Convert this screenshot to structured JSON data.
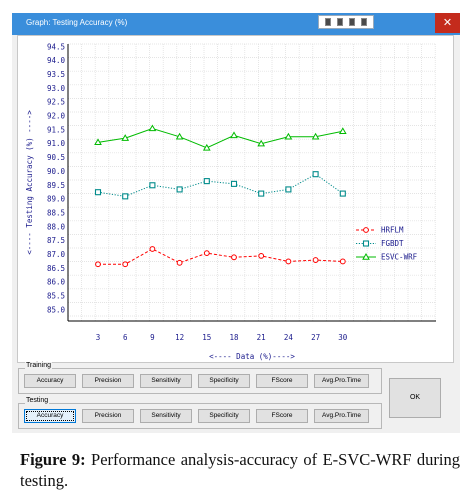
{
  "window": {
    "title": "Graph: Testing Accuracy (%)",
    "close_icon": "close-icon",
    "control_icon": "toolbar-icon"
  },
  "chart_data": {
    "type": "line",
    "xlabel": "<---- Data (%)---->",
    "ylabel": "<---- Testing Accuracy (%) ---->",
    "x": [
      3,
      6,
      9,
      12,
      15,
      18,
      21,
      24,
      27,
      30
    ],
    "x_tick_labels": [
      "3",
      "6",
      "9",
      "12",
      "15",
      "18",
      "21",
      "24",
      "27",
      "30"
    ],
    "y_tick_labels": [
      "85.0",
      "85.5",
      "86.0",
      "86.5",
      "87.0",
      "87.5",
      "88.0",
      "88.5",
      "89.0",
      "89.5",
      "90.0",
      "90.5",
      "91.0",
      "91.5",
      "92.0",
      "92.5",
      "93.0",
      "93.5",
      "94.0",
      "94.5"
    ],
    "ylim": [
      84.6,
      94.6
    ],
    "grid": true,
    "legend_position": "right",
    "series": [
      {
        "name": "HRFLM",
        "color": "#ff0000",
        "marker": "circle",
        "dash": "dashed",
        "values": [
          86.65,
          86.65,
          87.2,
          86.7,
          87.05,
          86.9,
          86.95,
          86.75,
          86.8,
          86.75
        ]
      },
      {
        "name": "FGBDT",
        "color": "#008b8b",
        "marker": "square",
        "dash": "dotted",
        "values": [
          89.25,
          89.1,
          89.5,
          89.35,
          89.65,
          89.55,
          89.2,
          89.35,
          89.9,
          89.2
        ]
      },
      {
        "name": "ESVC-WRF",
        "color": "#00bb00",
        "marker": "triangle",
        "dash": "solid",
        "values": [
          91.05,
          91.2,
          91.55,
          91.25,
          90.85,
          91.3,
          91.0,
          91.25,
          91.25,
          91.45
        ]
      }
    ]
  },
  "training": {
    "label": "Training",
    "buttons": [
      "Accuracy",
      "Precision",
      "Sensitivity",
      "Specificity",
      "FScore",
      "Avg.Pro.Time"
    ]
  },
  "testing": {
    "label": "Testing",
    "buttons": [
      "Accuracy",
      "Precision",
      "Sensitivity",
      "Specificity",
      "FScore",
      "Avg.Pro.Time"
    ]
  },
  "ok_label": "OK",
  "caption": {
    "figure_label": "Figure 9:",
    "text": " Performance analysis-accuracy of E-SVC-WRF during testing."
  }
}
